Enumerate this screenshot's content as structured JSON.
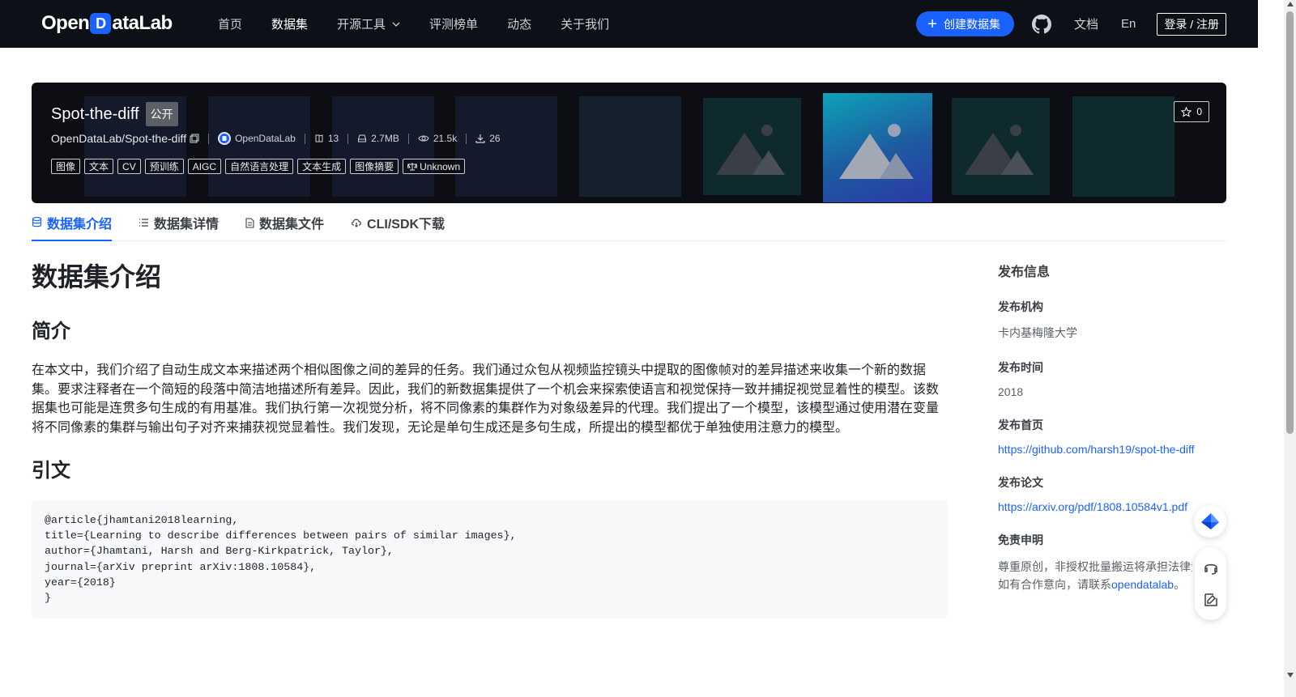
{
  "nav": {
    "logo": {
      "pre": "Open",
      "d": "D",
      "post": "ataLab"
    },
    "links": [
      "首页",
      "数据集",
      "开源工具",
      "评测榜单",
      "动态",
      "关于我们"
    ],
    "create_label": "创建数据集",
    "docs": "文档",
    "lang": "En",
    "login": "登录 / 注册"
  },
  "dataset": {
    "name": "Spot-the-diff",
    "visibility": "公开",
    "repo": "OpenDataLab/Spot-the-diff",
    "publisher": "OpenDataLab",
    "file_count": "13",
    "size": "2.7MB",
    "views": "21.5k",
    "downloads": "26",
    "tags": [
      "图像",
      "文本",
      "CV",
      "预训练",
      "AIGC",
      "自然语言处理",
      "文本生成",
      "图像摘要"
    ],
    "license": "Unknown",
    "stars": "0"
  },
  "tabs": [
    "数据集介绍",
    "数据集详情",
    "数据集文件",
    "CLI/SDK下载"
  ],
  "content": {
    "heading": "数据集介绍",
    "intro_heading": "简介",
    "intro_text": "在本文中，我们介绍了自动生成文本来描述两个相似图像之间的差异的任务。我们通过众包从视频监控镜头中提取的图像帧对的差异描述来收集一个新的数据集。要求注释者在一个简短的段落中简洁地描述所有差异。因此，我们的新数据集提供了一个机会来探索使语言和视觉保持一致并捕捉视觉显着性的模型。该数据集也可能是连贯多句生成的有用基准。我们执行第一次视觉分析，将不同像素的集群作为对象级差异的代理。我们提出了一个模型，该模型通过使用潜在变量将不同像素的集群与输出句子对齐来捕获视觉显着性。我们发现，无论是单句生成还是多句生成，所提出的模型都优于单独使用注意力的模型。",
    "citation_heading": "引文",
    "citation": "@article{jhamtani2018learning,\ntitle={Learning to describe differences between pairs of similar images},\nauthor={Jhamtani, Harsh and Berg-Kirkpatrick, Taylor},\njournal={arXiv preprint arXiv:1808.10584},\nyear={2018}\n}"
  },
  "sidebar": {
    "title": "发布信息",
    "org_label": "发布机构",
    "org": "卡内基梅隆大学",
    "time_label": "发布时间",
    "time": "2018",
    "home_label": "发布首页",
    "home": "https://github.com/harsh19/spot-the-diff",
    "paper_label": "发布论文",
    "paper": "https://arxiv.org/pdf/1808.10584v1.pdf",
    "disclaimer_label": "免责申明",
    "disclaimer_line1": "尊重原创，非授权批量搬运将承担法律责任。",
    "disclaimer_line2_pre": "如有合作意向，请联系",
    "disclaimer_link": "opendatalab",
    "disclaimer_line2_post": "。"
  },
  "colors": {
    "nav_bg": "#0d1117",
    "accent": "#1a62ff",
    "banner_bg": "#0c0e13"
  }
}
